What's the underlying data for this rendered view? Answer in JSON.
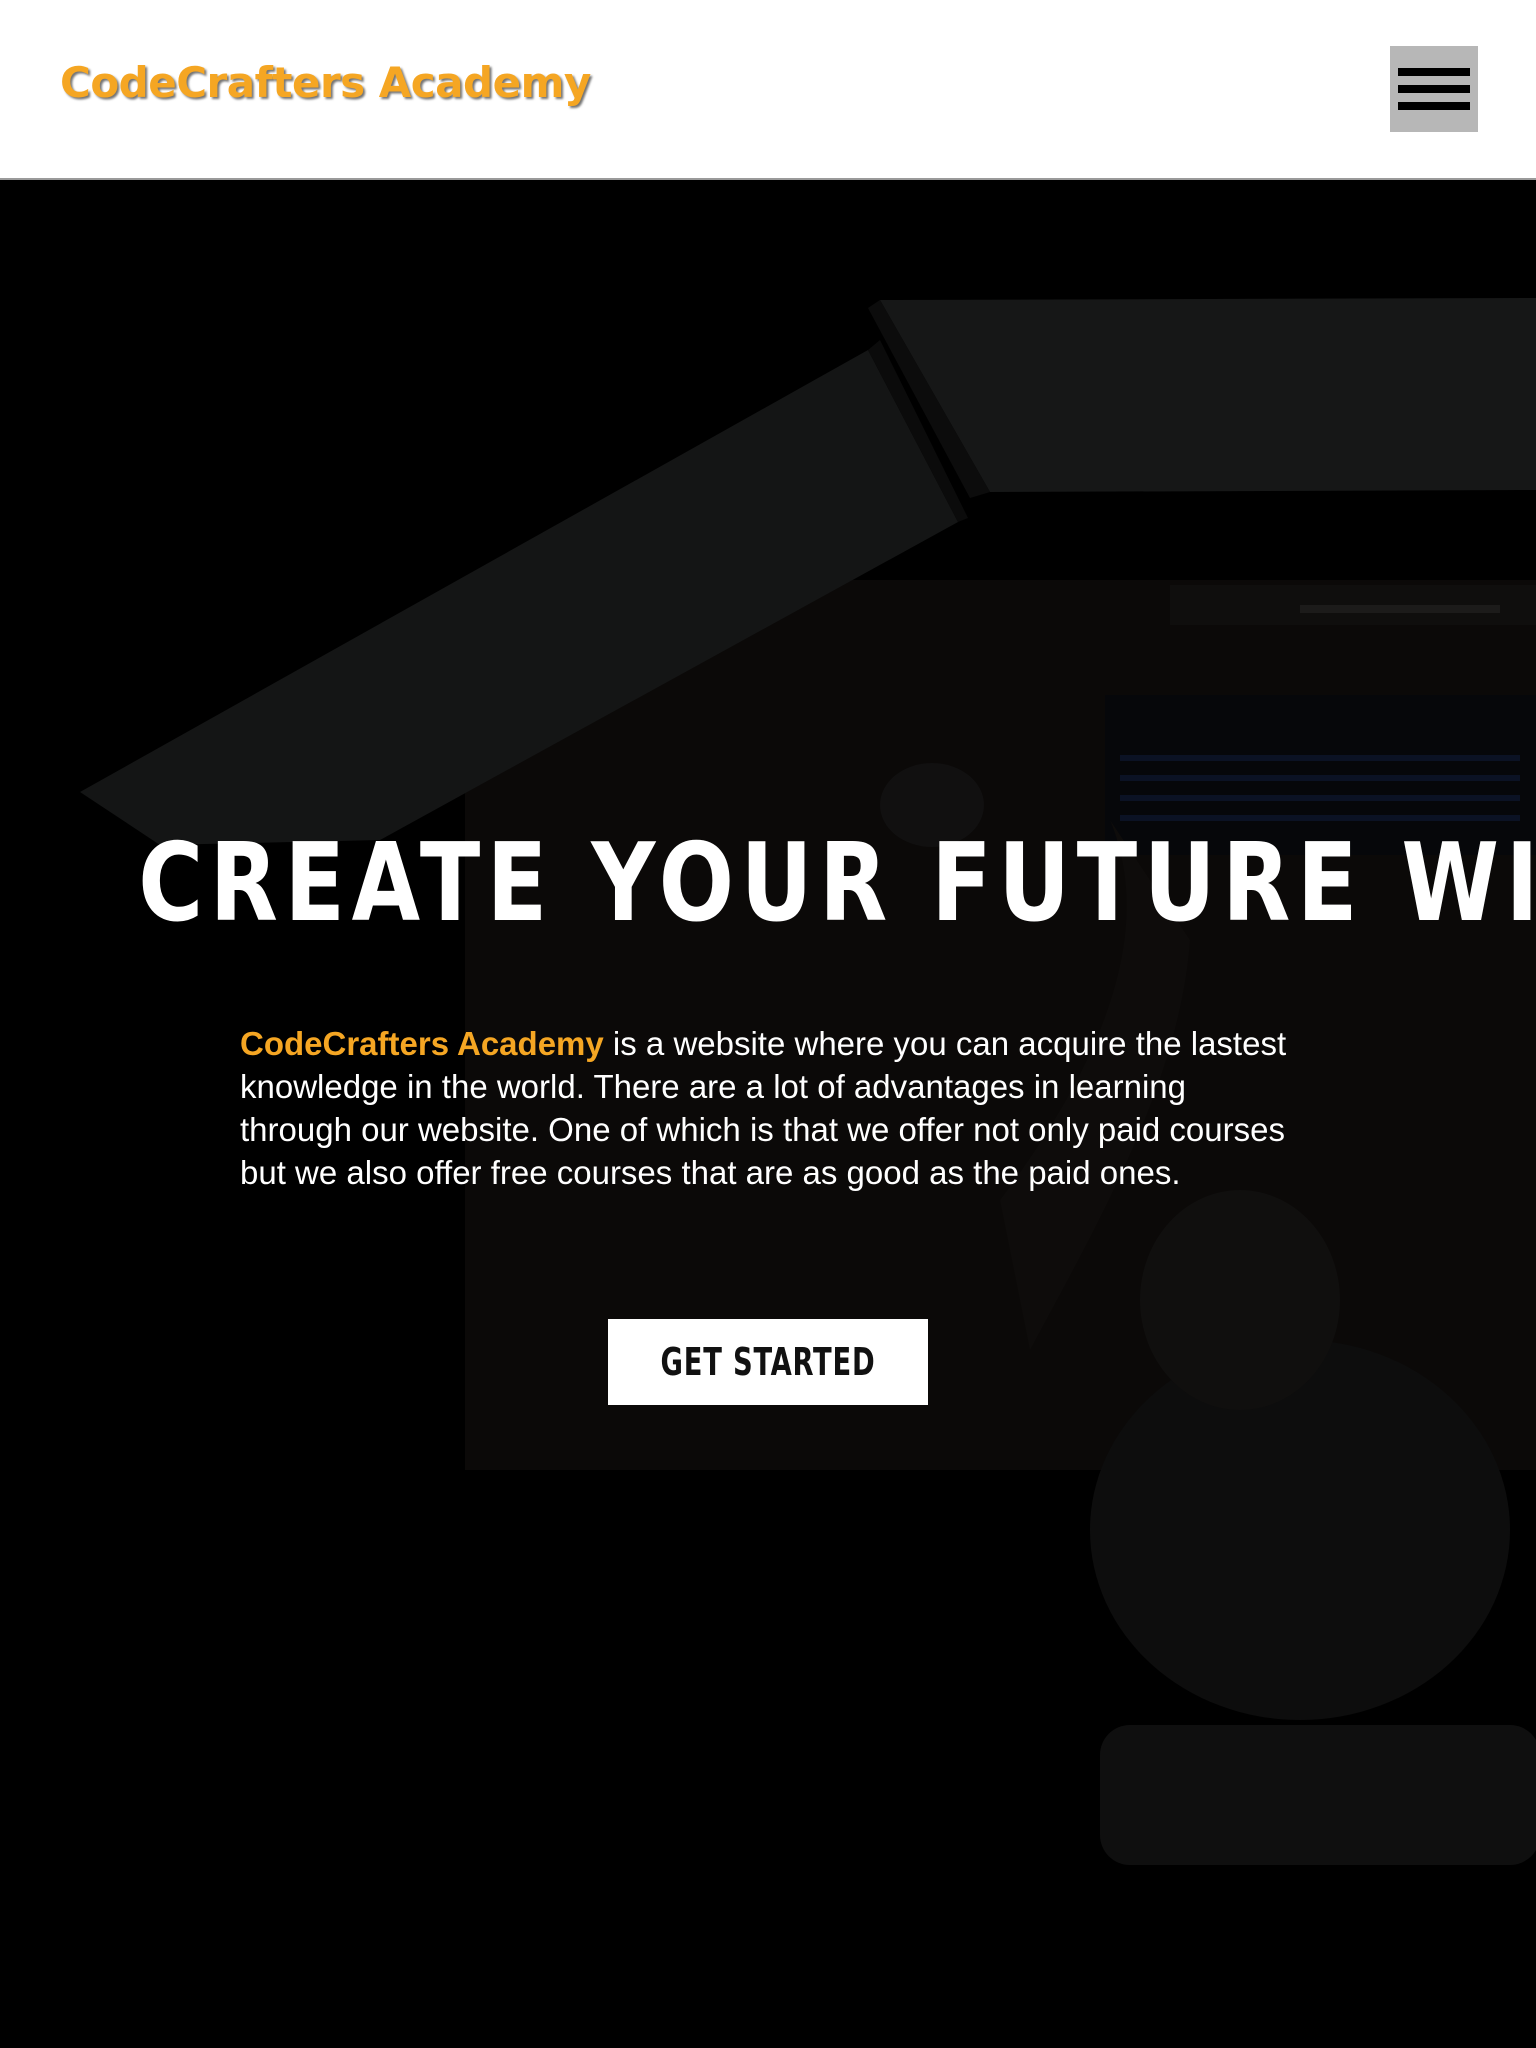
{
  "header": {
    "logo_text": "CodeCrafters Academy",
    "menu_icon": "hamburger-menu-icon"
  },
  "hero": {
    "title": "CREATE YOUR FUTURE WITH US",
    "description_brand": "CodeCrafters Academy",
    "description_rest": " is a website where you can acquire the lastest knowledge in the world. There are a lot of advantages in learning through our website. One of which is that we offer not only paid courses but we also offer free courses that are as good as the paid ones.",
    "cta_label": "GET STARTED",
    "background_image": "person-at-desk-with-monitors-photo"
  },
  "colors": {
    "accent": "#f5a623",
    "header_bg": "#ffffff",
    "hero_bg": "#000000",
    "menu_button_bg": "#b7b7b7"
  }
}
